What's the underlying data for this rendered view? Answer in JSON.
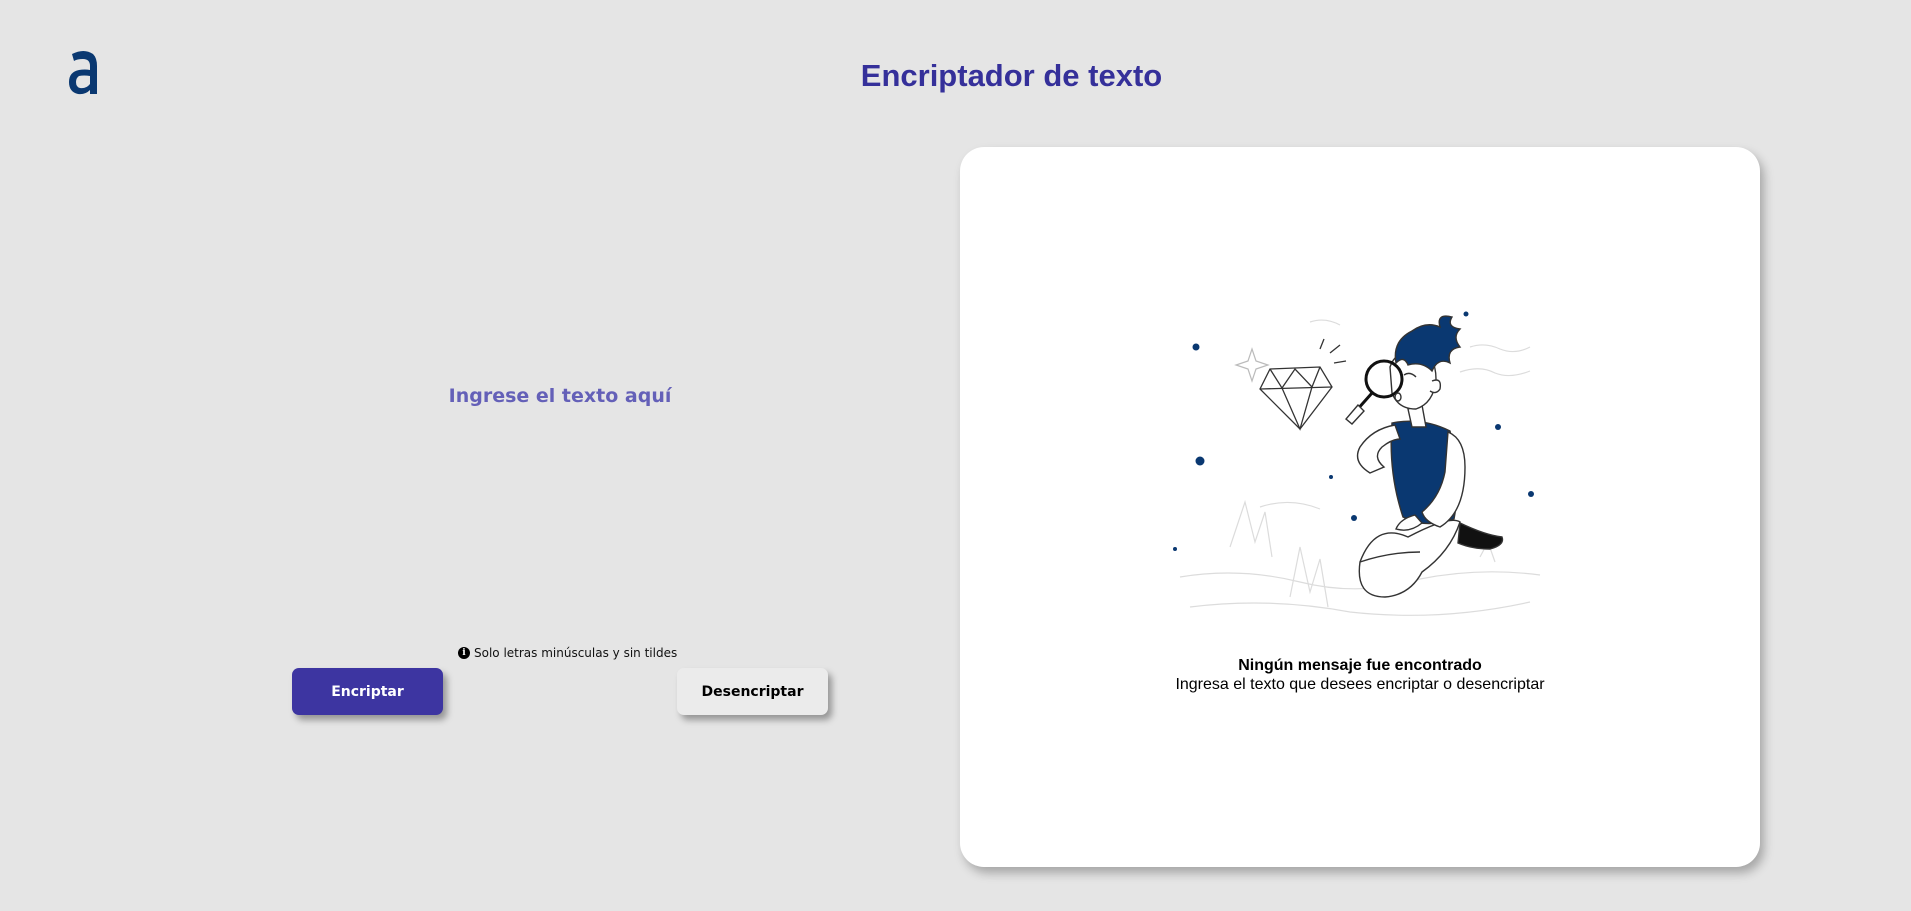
{
  "header": {
    "logo_icon": "alura-a-logo-icon",
    "title": "Encriptador de texto"
  },
  "input": {
    "placeholder": "Ingrese el texto aquí",
    "value": ""
  },
  "hint": {
    "icon": "info-circle-icon",
    "text": "Solo letras minúsculas y sin tildes"
  },
  "buttons": {
    "encrypt_label": "Encriptar",
    "decrypt_label": "Desencriptar"
  },
  "output": {
    "illustration": "person-magnifying-glass-diamond-illustration",
    "title": "Ningún mensaje fue encontrado",
    "subtitle": "Ingresa el texto que desees encriptar o desencriptar"
  },
  "colors": {
    "background": "#e5e5e5",
    "accent": "#35309a",
    "primary_button": "#3d35a1",
    "secondary_button": "#ebebeb",
    "illustration_blue": "#0a3871"
  }
}
